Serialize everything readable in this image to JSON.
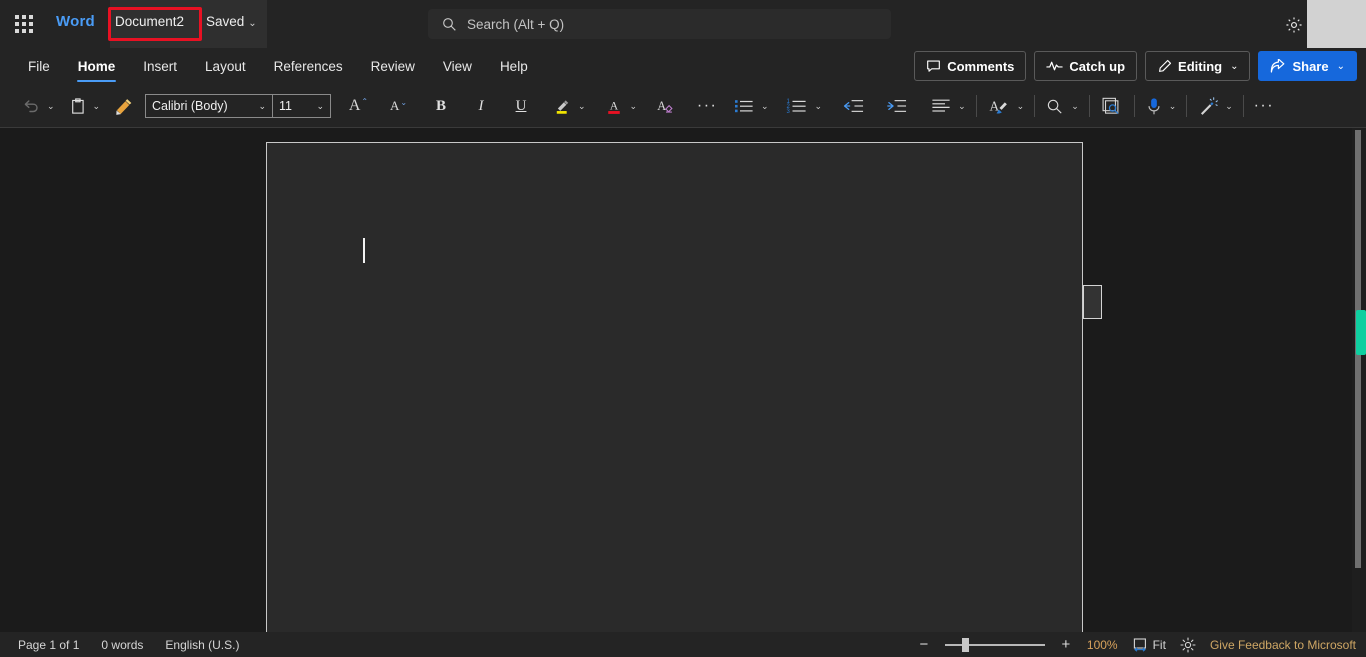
{
  "titlebar": {
    "app_launcher": "app-launcher-grid",
    "brand": "Word",
    "document_name": "Document2",
    "save_state": "Saved",
    "save_chevron": "⌄",
    "settings_icon": "gear-icon"
  },
  "search": {
    "placeholder": "Search (Alt + Q)",
    "value": "",
    "icon": "search-icon"
  },
  "ribbon": {
    "tabs": [
      {
        "label": "File",
        "active": false
      },
      {
        "label": "Home",
        "active": true
      },
      {
        "label": "Insert",
        "active": false
      },
      {
        "label": "Layout",
        "active": false
      },
      {
        "label": "References",
        "active": false
      },
      {
        "label": "Review",
        "active": false
      },
      {
        "label": "View",
        "active": false
      },
      {
        "label": "Help",
        "active": false
      }
    ],
    "buttons": {
      "comments": "Comments",
      "catch_up": "Catch up",
      "editing": "Editing",
      "share": "Share",
      "chevron": "⌄"
    },
    "accent_color": "#4a9cf6",
    "share_color": "#1668dc"
  },
  "toolbar": {
    "undo": "undo-icon",
    "paste": "paste-icon",
    "format_painter": "format-painter-icon",
    "font_name": "Calibri (Body)",
    "font_size": "11",
    "grow_font": "A",
    "shrink_font": "A",
    "bold": "B",
    "italic": "I",
    "underline": "U",
    "highlight_color": "#f2e500",
    "font_color": "#e81123",
    "clear_formatting": "A",
    "more_font": "···",
    "bullets": "bullet-list-icon",
    "numbering": "numbered-list-icon",
    "decrease_indent": "decrease-indent-icon",
    "increase_indent": "increase-indent-icon",
    "align": "align-left-icon",
    "styles": "styles-icon",
    "find": "find-icon",
    "editor": "editor-icon",
    "dictate": "dictate-icon",
    "designer": "designer-icon",
    "more_tools": "···",
    "collapse_ribbon": "⌄",
    "chevron": "⌄"
  },
  "document": {
    "page_background": "#2a2a2a",
    "caret_visible": true,
    "side_tab": "page-side-handle"
  },
  "statusbar": {
    "page": "Page 1 of 1",
    "words": "0 words",
    "language": "English (U.S.)",
    "zoom_minus": "−",
    "zoom_plus": "+",
    "zoom_percent": "100%",
    "fit": "Fit",
    "focus_icon": "brightness-icon",
    "feedback": "Give Feedback to Microsoft",
    "accent_text_color": "#d8a25c"
  },
  "scrollbar": {
    "thumb_color": "#0fcfa0"
  },
  "annotation": {
    "highlight_target": "Document2",
    "color": "#e81123"
  }
}
